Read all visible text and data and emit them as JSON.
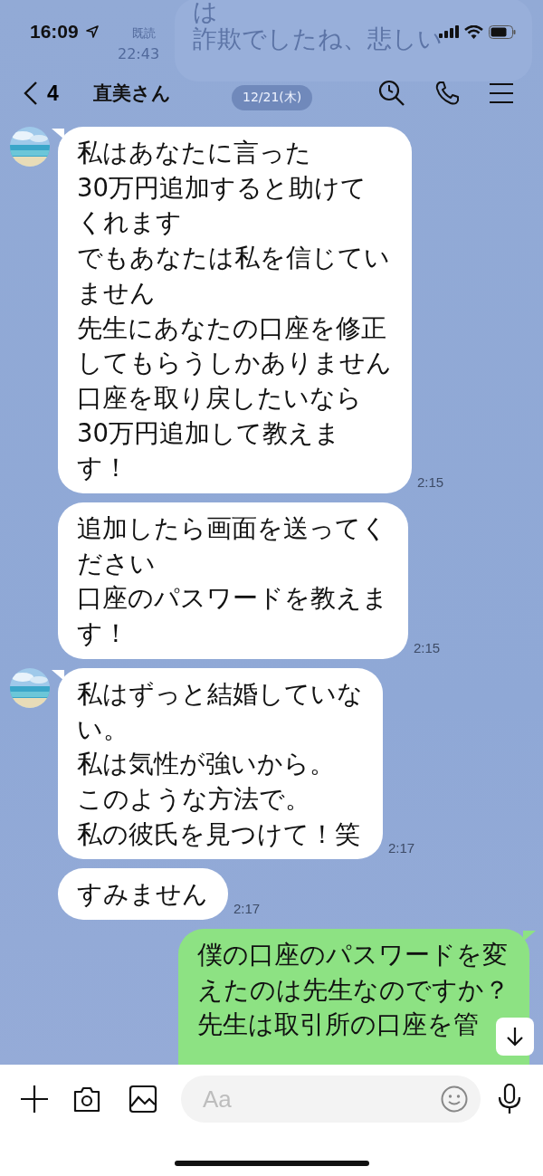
{
  "status_bar": {
    "time": "16:09"
  },
  "behind_header": {
    "lines": [
      "は",
      "詐欺でしたね、悲しい"
    ],
    "read": "既読",
    "time": "22:43",
    "date": "12/21(木)"
  },
  "header": {
    "back_count": "4",
    "title": "直美さん"
  },
  "messages": [
    {
      "kind": "incoming",
      "avatar": true,
      "lines": [
        "私はあなたに言った",
        "30万円追加すると助けて",
        "くれます",
        "でもあなたは私を信じてい",
        "ません",
        "先生にあなたの口座を修正",
        "してもらうしかありません",
        "口座を取り戻したいなら",
        "30万円追加して教えま",
        "す！"
      ],
      "time": "2:15"
    },
    {
      "kind": "incoming",
      "avatar": false,
      "lines": [
        "追加したら画面を送ってく",
        "ださい",
        "口座のパスワードを教えま",
        "す！"
      ],
      "time": "2:15"
    },
    {
      "kind": "incoming",
      "avatar": true,
      "lines": [
        "私はずっと結婚していな",
        "い。",
        "私は気性が強いから。",
        "このような方法で。",
        "私の彼氏を見つけて！笑"
      ],
      "time": "2:17"
    },
    {
      "kind": "incoming",
      "avatar": false,
      "lines": [
        "すみません"
      ],
      "time": "2:17"
    },
    {
      "kind": "outgoing",
      "lines": [
        "僕の口座のパスワードを変",
        "えたのは先生なのですか？",
        "先生は取引所の口座を管"
      ]
    }
  ],
  "input": {
    "placeholder": "Aa"
  }
}
